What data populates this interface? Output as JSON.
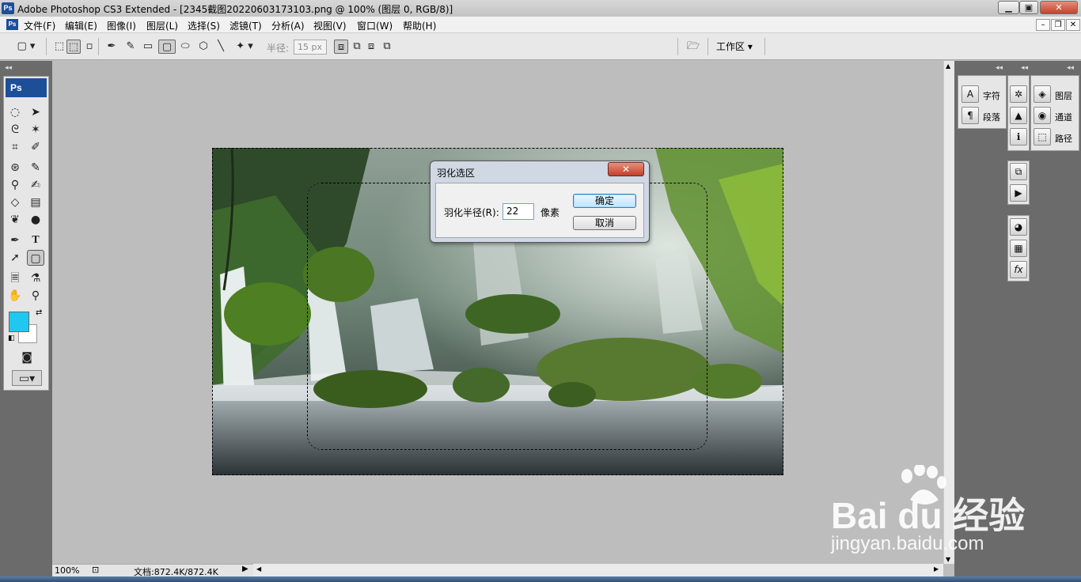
{
  "window": {
    "app_icon_label": "Ps",
    "title": "Adobe Photoshop CS3 Extended - [2345截图20220603173103.png @ 100% (图层 0, RGB/8)]"
  },
  "menu": {
    "items": [
      "文件(F)",
      "编辑(E)",
      "图像(I)",
      "图层(L)",
      "选择(S)",
      "滤镜(T)",
      "分析(A)",
      "视图(V)",
      "窗口(W)",
      "帮助(H)"
    ]
  },
  "options": {
    "radius_label": "半径:",
    "radius_value": "15 px",
    "workspace_label": "工作区"
  },
  "toolbox": {
    "header": "Ps"
  },
  "status": {
    "zoom": "100%",
    "doc_info": "文档:872.4K/872.4K"
  },
  "panels": {
    "col1": [
      "字符",
      "段落"
    ],
    "col3": [
      "图层",
      "通道",
      "路径"
    ]
  },
  "dialog": {
    "title": "羽化选区",
    "close_glyph": "✕",
    "field_label": "羽化半径(R):",
    "field_value": "22",
    "unit": "像素",
    "ok_label": "确定",
    "cancel_label": "取消"
  },
  "watermark": {
    "brand": "Bai du 经验",
    "url": "jingyan.baidu.com"
  },
  "colors": {
    "foreground": "#1ec8f0",
    "background": "#ffffff",
    "ps_blue": "#1d4f99"
  }
}
